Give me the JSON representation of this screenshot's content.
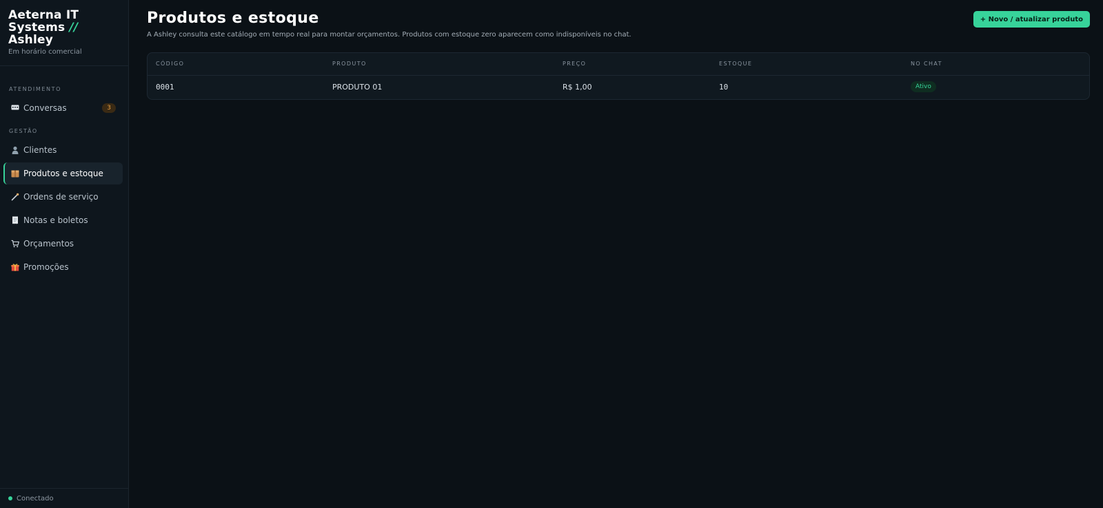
{
  "brand": {
    "line1": "Aeterna IT",
    "line2": "Systems",
    "slash": "//",
    "line3": "Ashley",
    "status": "Em horário comercial"
  },
  "sidebar": {
    "sections": [
      {
        "label": "ATENDIMENTO"
      },
      {
        "label": "GESTÃO"
      }
    ],
    "items": [
      {
        "label": "Conversas",
        "icon": "chat-icon",
        "badge": "3"
      },
      {
        "label": "Clientes",
        "icon": "person-icon"
      },
      {
        "label": "Produtos e estoque",
        "icon": "box-icon",
        "active": true
      },
      {
        "label": "Ordens de serviço",
        "icon": "wrench-icon"
      },
      {
        "label": "Notas e boletos",
        "icon": "receipt-icon"
      },
      {
        "label": "Orçamentos",
        "icon": "cart-icon"
      },
      {
        "label": "Promoções",
        "icon": "gift-icon"
      }
    ],
    "footer": "Conectado"
  },
  "page": {
    "title": "Produtos e estoque",
    "subtitle": "A Ashley consulta este catálogo em tempo real para montar orçamentos. Produtos com estoque zero aparecem como indisponíveis no chat.",
    "primary_button": "+ Novo / atualizar produto"
  },
  "table": {
    "columns": [
      "CÓDIGO",
      "PRODUTO",
      "PREÇO",
      "ESTOQUE",
      "NO CHAT"
    ],
    "rows": [
      {
        "codigo": "0001",
        "produto": "PRODUTO 01",
        "preco": "R$ 1,00",
        "estoque": "10",
        "status": "Ativo"
      }
    ]
  },
  "colors": {
    "accent": "#37d39a",
    "background": "#0b1116",
    "sidebar": "#0e161d",
    "badge": "#e8a045"
  }
}
